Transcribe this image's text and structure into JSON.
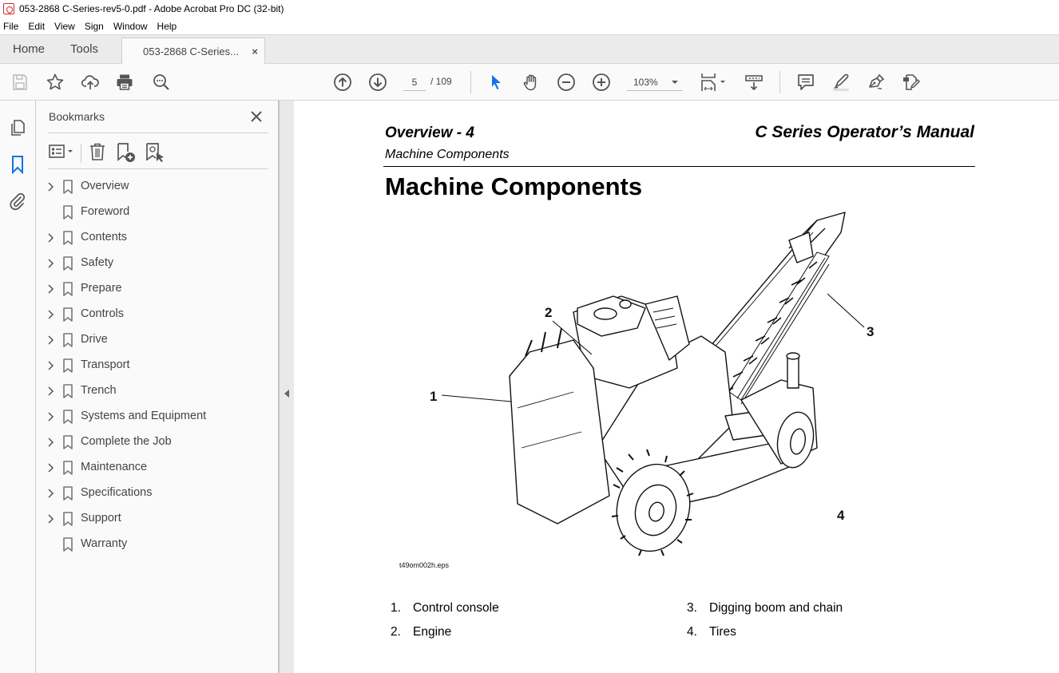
{
  "window": {
    "title": "053-2868 C-Series-rev5-0.pdf - Adobe Acrobat Pro DC (32-bit)"
  },
  "menu": [
    "File",
    "Edit",
    "View",
    "Sign",
    "Window",
    "Help"
  ],
  "tabs": {
    "home": "Home",
    "tools": "Tools",
    "document": "053-2868 C-Series...",
    "close_symbol": "×"
  },
  "toolbar": {
    "current_page": "5",
    "page_total": "/ 109",
    "zoom": "103%",
    "active_tool": "select",
    "accent_color": "#1473e6"
  },
  "bookmarks_panel": {
    "title": "Bookmarks",
    "items": [
      {
        "label": "Overview",
        "expandable": true
      },
      {
        "label": "Foreword",
        "expandable": false
      },
      {
        "label": "Contents",
        "expandable": true
      },
      {
        "label": "Safety",
        "expandable": true
      },
      {
        "label": "Prepare",
        "expandable": true
      },
      {
        "label": "Controls",
        "expandable": true
      },
      {
        "label": "Drive",
        "expandable": true
      },
      {
        "label": "Transport",
        "expandable": true
      },
      {
        "label": "Trench",
        "expandable": true
      },
      {
        "label": "Systems and Equipment",
        "expandable": true
      },
      {
        "label": "Complete the Job",
        "expandable": true
      },
      {
        "label": "Maintenance",
        "expandable": true
      },
      {
        "label": "Specifications",
        "expandable": true
      },
      {
        "label": "Support",
        "expandable": true
      },
      {
        "label": "Warranty",
        "expandable": false
      }
    ]
  },
  "document": {
    "header_left": "Overview - 4",
    "header_right": "C Series Operator’s Manual",
    "header_sub": "Machine Components",
    "heading": "Machine Components",
    "figure_caption": "t49om002h.eps",
    "callouts": [
      "1",
      "2",
      "3",
      "4"
    ],
    "legend": [
      {
        "num": "1.",
        "text": "Control console"
      },
      {
        "num": "2.",
        "text": "Engine"
      },
      {
        "num": "3.",
        "text": "Digging boom and chain"
      },
      {
        "num": "4.",
        "text": "Tires"
      }
    ]
  }
}
